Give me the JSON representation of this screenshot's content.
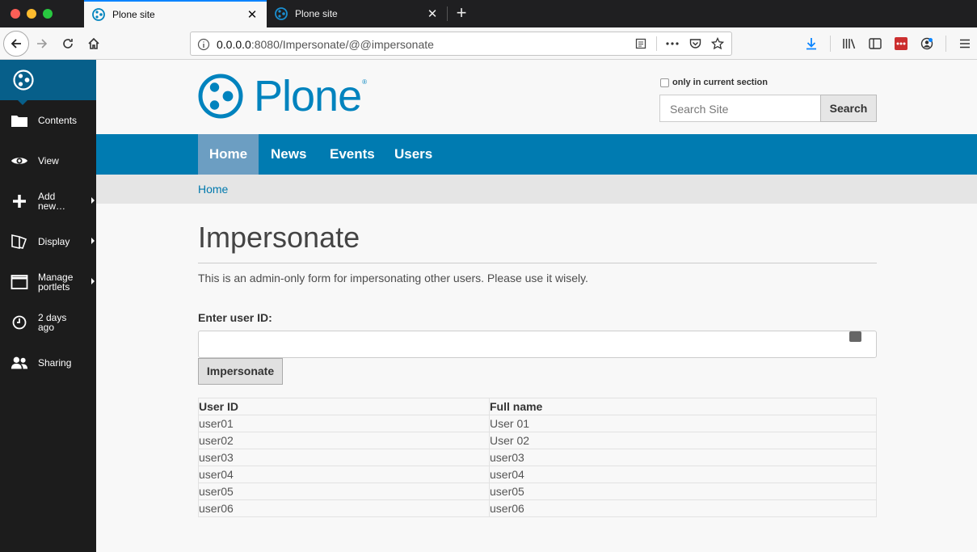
{
  "browser": {
    "tabs": [
      {
        "title": "Plone site",
        "active": true
      },
      {
        "title": "Plone site",
        "active": false
      }
    ],
    "url": {
      "host": "0.0.0.0",
      "rest": ":8080/Impersonate/@@impersonate"
    },
    "accent_color": "#0a84ff"
  },
  "toolbar": {
    "items": [
      {
        "label": "Contents",
        "icon": "folder-icon"
      },
      {
        "label": "View",
        "icon": "eye-icon"
      },
      {
        "label": "Add new…",
        "icon": "plus-icon"
      },
      {
        "label": "Display",
        "icon": "display-icon"
      },
      {
        "label": "Manage portlets",
        "icon": "window-icon"
      },
      {
        "label": "2 days ago",
        "icon": "clock-icon"
      },
      {
        "label": "Sharing",
        "icon": "users-icon"
      }
    ],
    "background": "#1c1c1c",
    "logo_background": "#075f8a"
  },
  "header": {
    "logo_text": "Plone",
    "logo_mark": "®",
    "section_filter_label": "only in current section",
    "search_placeholder": "Search Site",
    "search_button": "Search",
    "brand_color": "#0083be"
  },
  "nav": {
    "items": [
      "Home",
      "News",
      "Events",
      "Users"
    ],
    "background": "#007bb1"
  },
  "breadcrumb": {
    "home": "Home"
  },
  "page": {
    "title": "Impersonate",
    "description": "This is an admin-only form for impersonating other users. Please use it wisely.",
    "field_label": "Enter user ID:",
    "user_id_value": "",
    "submit_label": "Impersonate"
  },
  "users_table": {
    "headers": [
      "User ID",
      "Full name"
    ],
    "rows": [
      [
        "user01",
        "User 01"
      ],
      [
        "user02",
        "User 02"
      ],
      [
        "user03",
        "user03"
      ],
      [
        "user04",
        "user04"
      ],
      [
        "user05",
        "user05"
      ],
      [
        "user06",
        "user06"
      ]
    ]
  }
}
